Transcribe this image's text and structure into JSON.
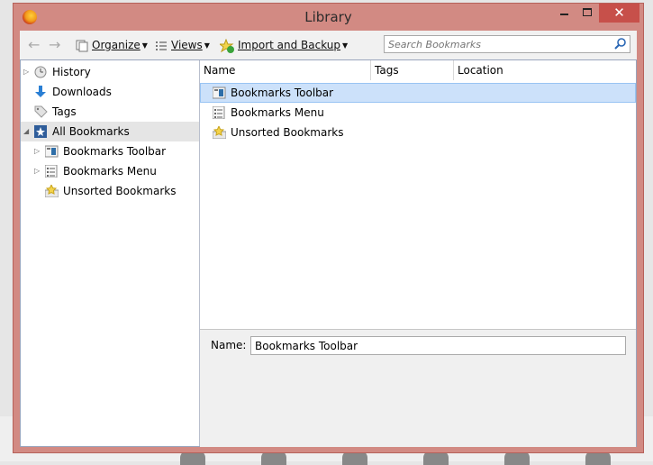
{
  "window": {
    "title": "Library"
  },
  "toolbar": {
    "organize_label": "Organize",
    "views_label": "Views",
    "import_label": "Import and Backup",
    "search_placeholder": "Search Bookmarks"
  },
  "sidebar": {
    "items": [
      {
        "label": "History",
        "icon": "clock-icon"
      },
      {
        "label": "Downloads",
        "icon": "download-arrow-icon"
      },
      {
        "label": "Tags",
        "icon": "tag-icon"
      },
      {
        "label": "All Bookmarks",
        "icon": "all-bookmarks-icon",
        "selected": true
      },
      {
        "label": "Bookmarks Toolbar",
        "icon": "bookmarks-toolbar-icon"
      },
      {
        "label": "Bookmarks Menu",
        "icon": "bookmarks-menu-icon"
      },
      {
        "label": "Unsorted Bookmarks",
        "icon": "unsorted-bookmarks-icon"
      }
    ]
  },
  "list": {
    "columns": [
      "Name",
      "Tags",
      "Location"
    ],
    "rows": [
      {
        "name": "Bookmarks Toolbar",
        "icon": "bookmarks-toolbar-icon",
        "selected": true
      },
      {
        "name": "Bookmarks Menu",
        "icon": "bookmarks-menu-icon"
      },
      {
        "name": "Unsorted Bookmarks",
        "icon": "unsorted-bookmarks-icon"
      }
    ]
  },
  "details": {
    "name_label": "Name:",
    "name_value": "Bookmarks Toolbar"
  },
  "colors": {
    "frame": "#d28a83",
    "close_button": "#c7504a",
    "selection": "#cce1fa"
  }
}
